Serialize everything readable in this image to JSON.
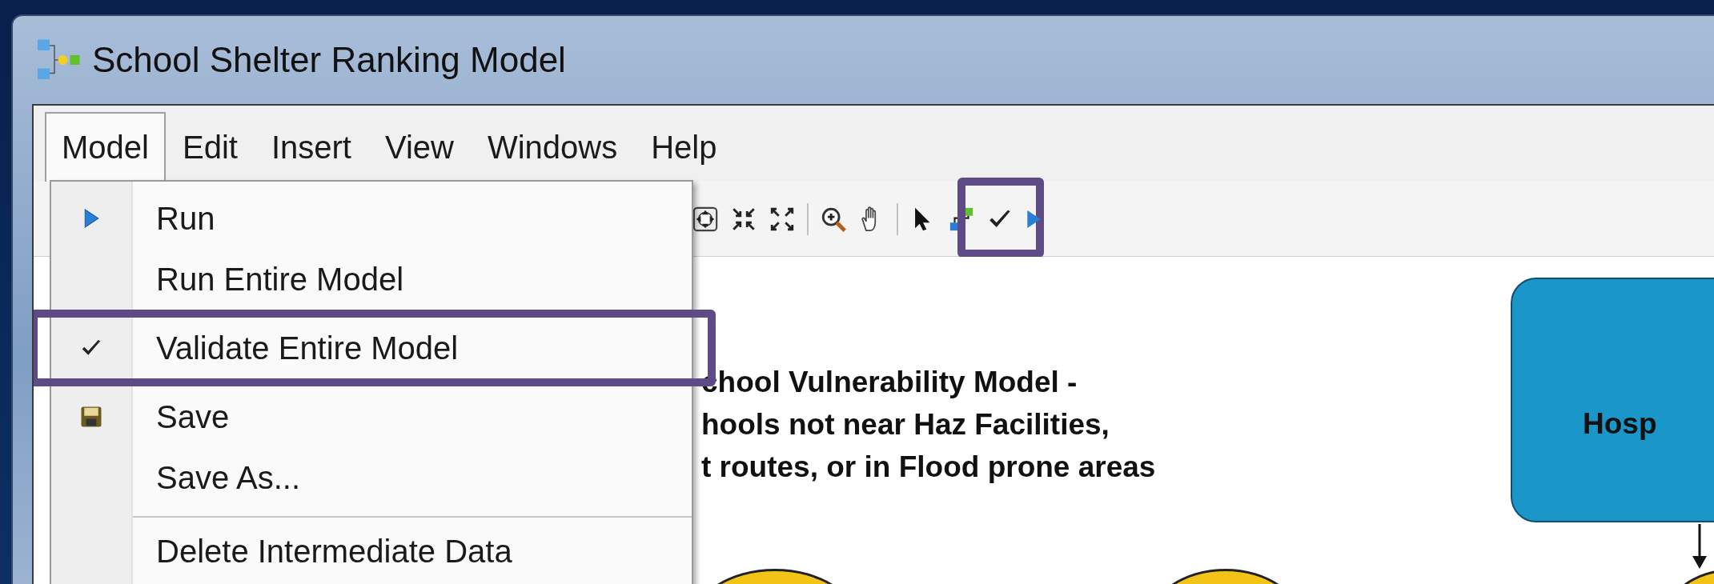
{
  "window": {
    "title": "School Shelter Ranking Model"
  },
  "menu_bar": [
    {
      "label": "Model",
      "selected": true
    },
    {
      "label": "Edit",
      "selected": false
    },
    {
      "label": "Insert",
      "selected": false
    },
    {
      "label": "View",
      "selected": false
    },
    {
      "label": "Windows",
      "selected": false
    },
    {
      "label": "Help",
      "selected": false
    }
  ],
  "model_menu": {
    "items": [
      {
        "kind": "run",
        "label": "Run",
        "highlighted": false
      },
      {
        "kind": "plain",
        "label": "Run Entire Model",
        "highlighted": false
      },
      {
        "kind": "check",
        "label": "Validate Entire Model",
        "highlighted": true
      },
      {
        "kind": "save",
        "label": "Save",
        "highlighted": false
      },
      {
        "kind": "plain",
        "label": "Save As...",
        "highlighted": false
      },
      {
        "kind": "separator"
      },
      {
        "kind": "plain",
        "label": "Delete Intermediate Data",
        "highlighted": false
      }
    ]
  },
  "toolbar": [
    {
      "kind": "fit",
      "highlighted": false
    },
    {
      "kind": "shrink",
      "highlighted": false
    },
    {
      "kind": "expand",
      "highlighted": false
    },
    {
      "kind": "divider"
    },
    {
      "kind": "zoom",
      "highlighted": false
    },
    {
      "kind": "pan",
      "highlighted": false
    },
    {
      "kind": "divider"
    },
    {
      "kind": "pointer",
      "highlighted": false
    },
    {
      "kind": "connect",
      "highlighted": false
    },
    {
      "kind": "validate",
      "highlighted": true
    },
    {
      "kind": "run",
      "highlighted": false
    }
  ],
  "diagram": {
    "note_lines": [
      "chool Vulnerability Model -",
      "hools not near Haz Facilities,",
      "t routes, or in Flood prone areas"
    ],
    "process_box": {
      "label": "Hosp"
    }
  }
}
